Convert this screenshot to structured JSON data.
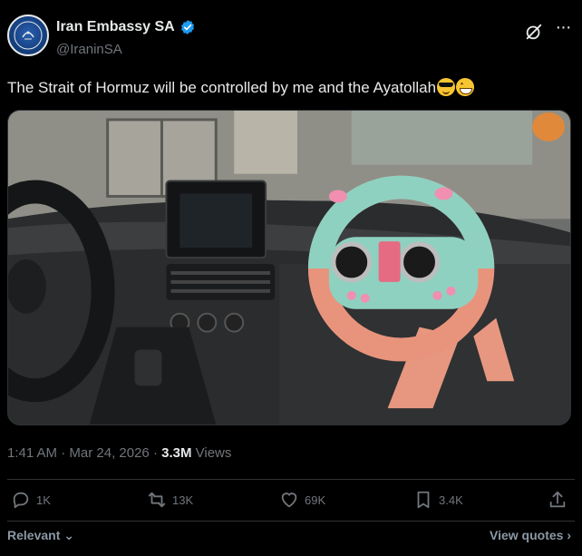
{
  "account": {
    "name": "Iran Embassy SA",
    "handle": "@IraninSA",
    "verified_color": "#1d9bf0"
  },
  "tweet": {
    "text": "The Strait of Hormuz will be controlled by me and the Ayatollah",
    "emojis": [
      "smiling-face-with-sunglasses",
      "grinning-face-with-smiling-eyes"
    ]
  },
  "meta": {
    "time": "1:41 AM",
    "sep1": " · ",
    "date": "Mar 24, 2026",
    "sep2": " · ",
    "views_count": "3.3M",
    "views_label": " Views"
  },
  "actions": {
    "replies": "1K",
    "reposts": "13K",
    "likes": "69K",
    "bookmarks": "3.4K"
  },
  "footer": {
    "relevant": "Relevant",
    "view_quotes": "View quotes"
  },
  "colors": {
    "background": "#000000",
    "text": "#e7e9ea",
    "muted": "#71767b",
    "border": "#2f3336"
  }
}
